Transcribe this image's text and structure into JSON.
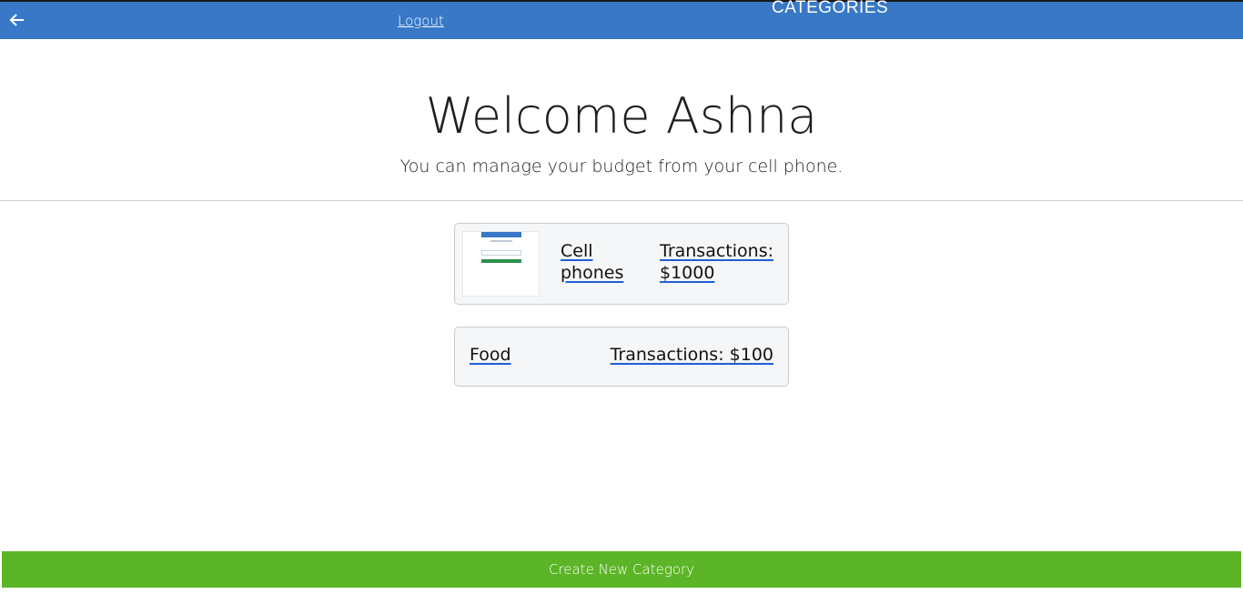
{
  "header": {
    "back_icon": "arrow-left-icon",
    "logout_label": "Logout",
    "title": "CATEGORIES",
    "background_color": "#3878c7"
  },
  "welcome": {
    "heading": "Welcome Ashna",
    "tagline": "You can manage your budget from your cell phone."
  },
  "categories": [
    {
      "name": "Cell phones",
      "transactions": "Transactions: $1000",
      "has_thumbnail": true
    },
    {
      "name": "Food",
      "transactions": "Transactions: $100",
      "has_thumbnail": false
    }
  ],
  "footer": {
    "create_label": "Create New Category",
    "button_color": "#5cb527"
  }
}
